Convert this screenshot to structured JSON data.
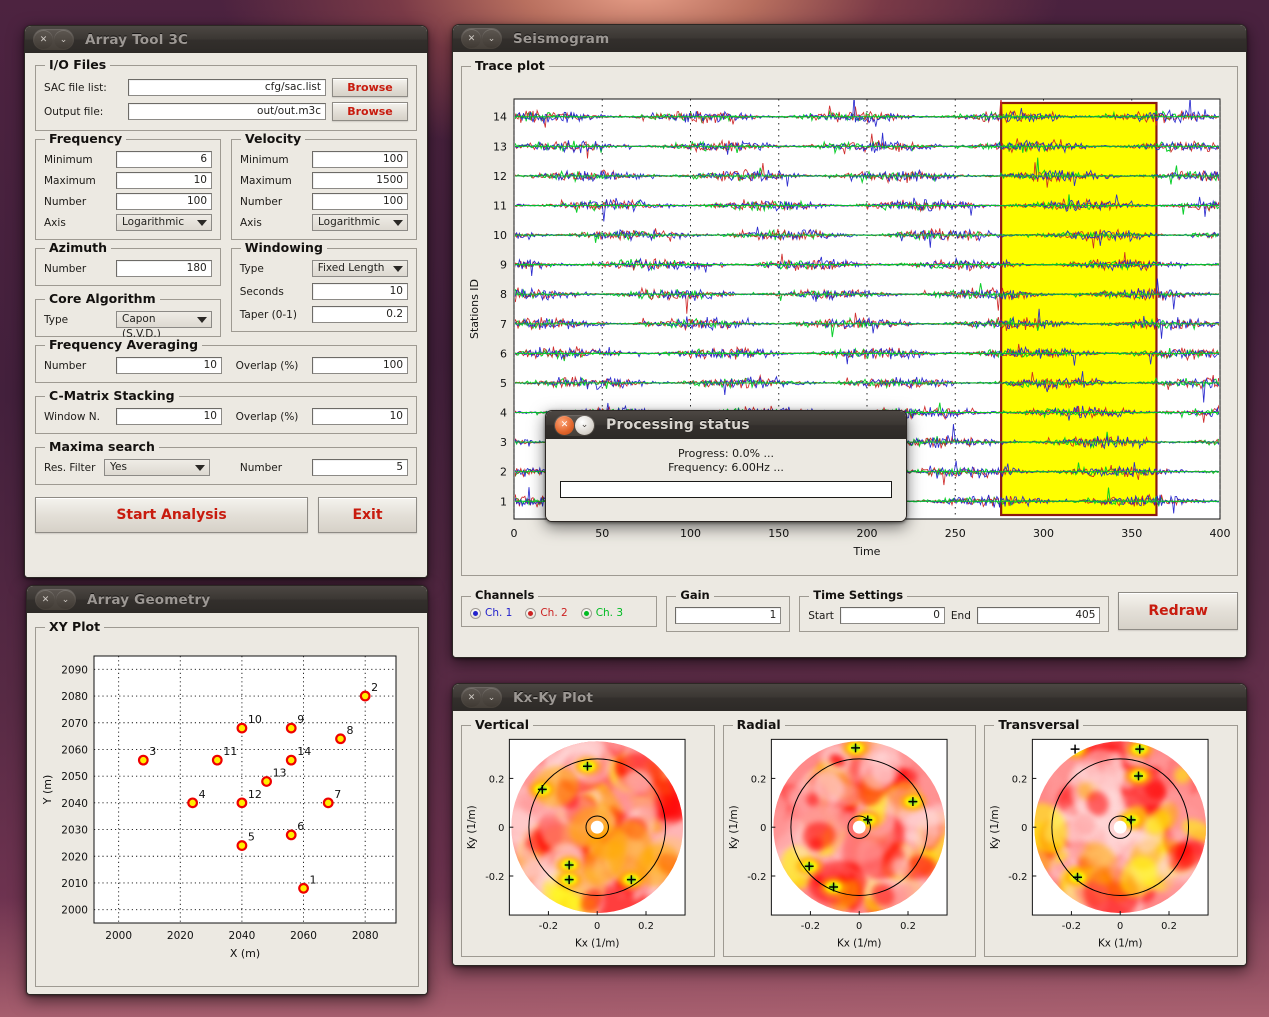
{
  "windows": {
    "array_tool": {
      "title": "Array Tool 3C",
      "io": {
        "group": "I/O Files",
        "sac_label": "SAC file list:",
        "sac_value": "cfg/sac.list",
        "out_label": "Output file:",
        "out_value": "out/out.m3c",
        "browse1": "Browse",
        "browse2": "Browse"
      },
      "frequency": {
        "group": "Frequency",
        "min_label": "Minimum",
        "min_value": "6",
        "max_label": "Maximum",
        "max_value": "10",
        "num_label": "Number",
        "num_value": "100",
        "axis_label": "Axis",
        "axis_value": "Logarithmic"
      },
      "velocity": {
        "group": "Velocity",
        "min_label": "Minimum",
        "min_value": "100",
        "max_label": "Maximum",
        "max_value": "1500",
        "num_label": "Number",
        "num_value": "100",
        "axis_label": "Axis",
        "axis_value": "Logarithmic"
      },
      "azimuth": {
        "group": "Azimuth",
        "num_label": "Number",
        "num_value": "180"
      },
      "core": {
        "group": "Core Algorithm",
        "type_label": "Type",
        "type_value": "Capon (S.V.D.)"
      },
      "windowing": {
        "group": "Windowing",
        "type_label": "Type",
        "type_value": "Fixed Length",
        "seconds_label": "Seconds",
        "seconds_value": "10",
        "taper_label": "Taper (0-1)",
        "taper_value": "0.2"
      },
      "freq_avg": {
        "group": "Frequency Averaging",
        "num_label": "Number",
        "num_value": "10",
        "overlap_label": "Overlap (%)",
        "overlap_value": "100"
      },
      "cmatrix": {
        "group": "C-Matrix Stacking",
        "win_label": "Window N.",
        "win_value": "10",
        "overlap_label": "Overlap (%)",
        "overlap_value": "10"
      },
      "maxima": {
        "group": "Maxima search",
        "filter_label": "Res. Filter",
        "filter_value": "Yes",
        "num_label": "Number",
        "num_value": "5"
      },
      "start_button": "Start Analysis",
      "exit_button": "Exit"
    },
    "seismogram": {
      "title": "Seismogram",
      "trace_group": "Trace plot",
      "channels": {
        "group": "Channels",
        "items": [
          {
            "label": "Ch. 1",
            "color": "#2222cc"
          },
          {
            "label": "Ch. 2",
            "color": "#cc2222"
          },
          {
            "label": "Ch. 3",
            "color": "#00cc22"
          }
        ]
      },
      "gain": {
        "group": "Gain",
        "value": "1"
      },
      "time": {
        "group": "Time Settings",
        "start_label": "Start",
        "start_value": "0",
        "end_label": "End",
        "end_value": "405"
      },
      "redraw_button": "Redraw"
    },
    "array_geometry": {
      "title": "Array Geometry",
      "group": "XY Plot"
    },
    "kxky": {
      "title": "Kx-Ky Plot",
      "panels": [
        {
          "group": "Vertical"
        },
        {
          "group": "Radial"
        },
        {
          "group": "Transversal"
        }
      ]
    },
    "processing": {
      "title": "Processing status",
      "progress_text": "Progress: 0.0% ...",
      "frequency_text": "Frequency: 6.00Hz ...",
      "progress_value": 0
    }
  },
  "chart_data": [
    {
      "id": "trace_plot",
      "type": "line",
      "title": "Trace plot",
      "xlabel": "Time",
      "ylabel": "Stations ID",
      "xlim": [
        0,
        400
      ],
      "xticks": [
        0,
        50,
        100,
        150,
        200,
        250,
        300,
        350,
        400
      ],
      "ylim": [
        0.4,
        14.6
      ],
      "yticks": [
        1,
        2,
        3,
        4,
        5,
        6,
        7,
        8,
        9,
        10,
        11,
        12,
        13,
        14
      ],
      "grid": true,
      "series": [
        {
          "name": "Ch. 1",
          "color": "#2222cc"
        },
        {
          "name": "Ch. 2",
          "color": "#cc2222"
        },
        {
          "name": "Ch. 3",
          "color": "#00cc22"
        }
      ],
      "selection_window": {
        "start": 276,
        "end": 364,
        "fill": "#ffff00",
        "stroke": "#8b1a10"
      },
      "n_traces": 14
    },
    {
      "id": "xy_plot",
      "type": "scatter",
      "title": "XY Plot",
      "xlabel": "X (m)",
      "ylabel": "Y (m)",
      "xlim": [
        1992,
        2090
      ],
      "ylim": [
        1995,
        2095
      ],
      "xticks": [
        2000,
        2020,
        2040,
        2060,
        2080
      ],
      "yticks": [
        2000,
        2010,
        2020,
        2030,
        2040,
        2050,
        2060,
        2070,
        2080,
        2090
      ],
      "grid": true,
      "marker": {
        "fill": "#ffee00",
        "stroke": "#ee0000"
      },
      "points": [
        {
          "label": "1",
          "x": 2060,
          "y": 2008
        },
        {
          "label": "2",
          "x": 2080,
          "y": 2080
        },
        {
          "label": "3",
          "x": 2008,
          "y": 2056
        },
        {
          "label": "4",
          "x": 2024,
          "y": 2040
        },
        {
          "label": "5",
          "x": 2040,
          "y": 2024
        },
        {
          "label": "6",
          "x": 2056,
          "y": 2028
        },
        {
          "label": "7",
          "x": 2068,
          "y": 2040
        },
        {
          "label": "8",
          "x": 2072,
          "y": 2064
        },
        {
          "label": "9",
          "x": 2056,
          "y": 2068
        },
        {
          "label": "10",
          "x": 2040,
          "y": 2068
        },
        {
          "label": "11",
          "x": 2032,
          "y": 2056
        },
        {
          "label": "12",
          "x": 2040,
          "y": 2040
        },
        {
          "label": "13",
          "x": 2048,
          "y": 2048
        },
        {
          "label": "14",
          "x": 2056,
          "y": 2056
        }
      ]
    },
    {
      "id": "kxky_vertical",
      "type": "heatmap",
      "title": "Vertical",
      "xlabel": "Kx (1/m)",
      "ylabel": "Ky (1/m)",
      "xlim": [
        -0.36,
        0.36
      ],
      "ylim": [
        -0.36,
        0.36
      ],
      "xticks": [
        -0.2,
        0,
        0.2
      ],
      "yticks": [
        -0.2,
        0,
        0.2
      ],
      "colormap": [
        "#ffffff",
        "#ffd9d9",
        "#ff9a9a",
        "#ff5555",
        "#ff0000",
        "#ffaa00",
        "#ffff00",
        "#66dd33"
      ],
      "rings": [
        0.046,
        0.28
      ],
      "maxima": [
        {
          "kx": -0.04,
          "ky": 0.25
        },
        {
          "kx": -0.225,
          "ky": 0.155
        },
        {
          "kx": -0.115,
          "ky": -0.155
        },
        {
          "kx": -0.115,
          "ky": -0.215
        },
        {
          "kx": 0.14,
          "ky": -0.215
        }
      ]
    },
    {
      "id": "kxky_radial",
      "type": "heatmap",
      "title": "Radial",
      "xlabel": "Kx (1/m)",
      "ylabel": "Ky (1/m)",
      "xlim": [
        -0.36,
        0.36
      ],
      "ylim": [
        -0.36,
        0.36
      ],
      "xticks": [
        -0.2,
        0,
        0.2
      ],
      "yticks": [
        -0.2,
        0,
        0.2
      ],
      "colormap": [
        "#ffffff",
        "#ffd9d9",
        "#ff9a9a",
        "#ff5555",
        "#ff0000",
        "#ffaa00",
        "#ffff00",
        "#66dd33"
      ],
      "rings": [
        0.046,
        0.28
      ],
      "maxima": [
        {
          "kx": -0.015,
          "ky": 0.325
        },
        {
          "kx": 0.22,
          "ky": 0.105
        },
        {
          "kx": 0.035,
          "ky": 0.03
        },
        {
          "kx": -0.205,
          "ky": -0.16
        },
        {
          "kx": -0.105,
          "ky": -0.245
        }
      ]
    },
    {
      "id": "kxky_transversal",
      "type": "heatmap",
      "title": "Transversal",
      "xlabel": "Kx (1/m)",
      "ylabel": "Ky (1/m)",
      "xlim": [
        -0.36,
        0.36
      ],
      "ylim": [
        -0.36,
        0.36
      ],
      "xticks": [
        -0.2,
        0,
        0.2
      ],
      "yticks": [
        -0.2,
        0,
        0.2
      ],
      "colormap": [
        "#ffffff",
        "#ffd9d9",
        "#ff9a9a",
        "#ff5555",
        "#ff0000",
        "#ffaa00",
        "#ffff00",
        "#66dd33"
      ],
      "rings": [
        0.046,
        0.28
      ],
      "maxima": [
        {
          "kx": -0.185,
          "ky": 0.32
        },
        {
          "kx": 0.08,
          "ky": 0.32
        },
        {
          "kx": 0.075,
          "ky": 0.21
        },
        {
          "kx": 0.045,
          "ky": 0.03
        },
        {
          "kx": -0.175,
          "ky": -0.205
        }
      ]
    }
  ]
}
